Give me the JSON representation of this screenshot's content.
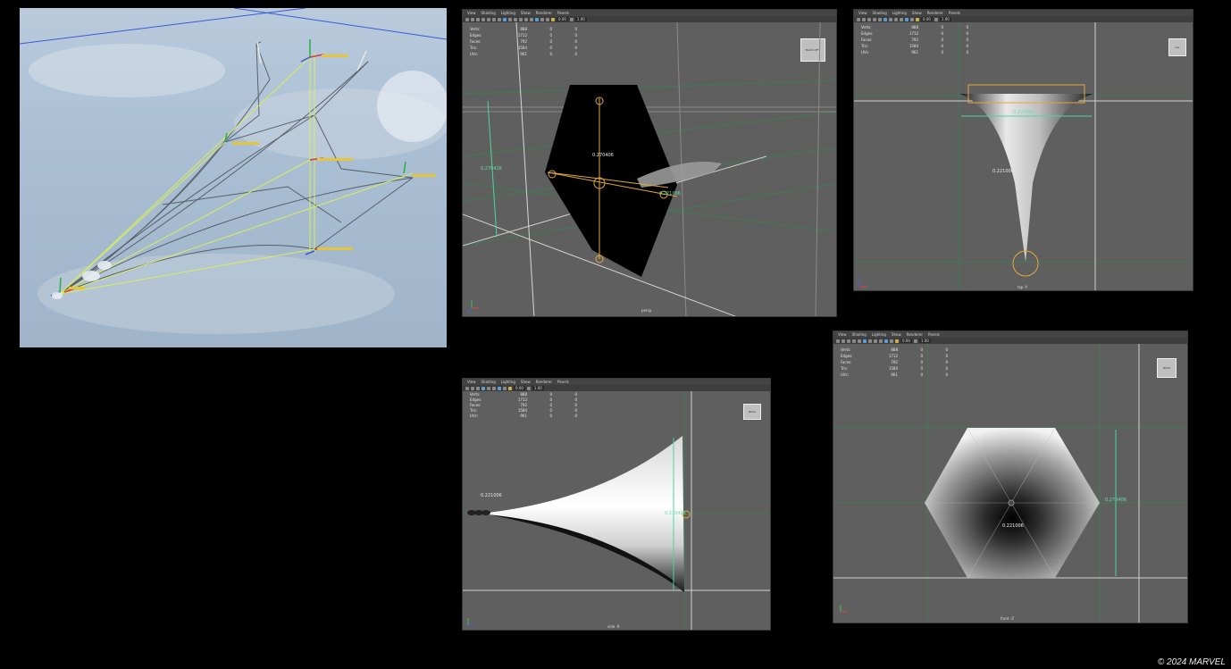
{
  "menu": [
    "View",
    "Shading",
    "Lighting",
    "Show",
    "Renderer",
    "Panels"
  ],
  "toolbar": {
    "field_a": "0.00",
    "field_b": "1.00"
  },
  "hud": [
    {
      "label": "Verts:",
      "value": "888",
      "v2": "0",
      "v3": "0"
    },
    {
      "label": "Edges:",
      "value": "1712",
      "v2": "0",
      "v3": "0"
    },
    {
      "label": "Faces:",
      "value": "792",
      "v2": "0",
      "v3": "0"
    },
    {
      "label": "Tris:",
      "value": "1584",
      "v2": "0",
      "v3": "0"
    },
    {
      "label": "UVs:",
      "value": "961",
      "v2": "0",
      "v3": "0"
    }
  ],
  "views": {
    "persp": {
      "camera": "persp",
      "cube": "BACK  LEFT",
      "m1": "0.270416",
      "m2": "0.221006",
      "m3": "0.270406"
    },
    "top": {
      "camera": "top -Y",
      "cube": "top",
      "m1": "0.270406",
      "m2": "0.221006"
    },
    "side": {
      "camera": "side -X",
      "cube": "BACK",
      "m1": "0.270406",
      "m2": "0.221006"
    },
    "front": {
      "camera": "front -Z",
      "cube": "BACK",
      "m1": "0.270406",
      "m2": "0.221006"
    }
  },
  "copyright": "© 2024 MARVEL"
}
